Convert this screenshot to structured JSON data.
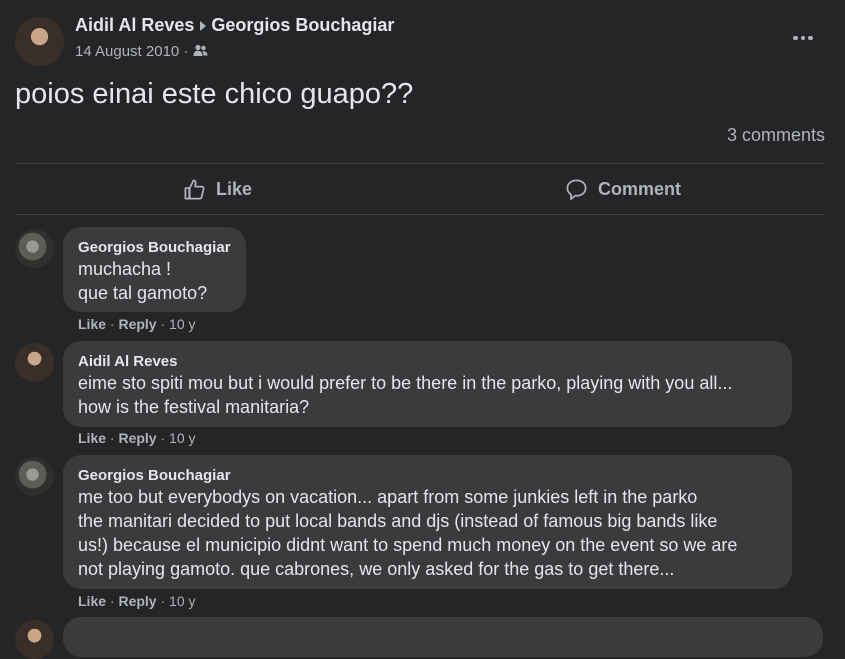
{
  "post": {
    "author": "Aidil Al Reves",
    "target": "Georgios Bouchagiar",
    "date": "14 August 2010",
    "separator": "·",
    "text": "poios einai este chico guapo??",
    "comment_count": "3 comments",
    "like_label": "Like",
    "comment_label": "Comment"
  },
  "comments": [
    {
      "author": "Georgios Bouchagiar",
      "text": "muchacha !\nque tal gamoto?",
      "like": "Like",
      "reply": "Reply",
      "time": "10 y"
    },
    {
      "author": "Aidil Al Reves",
      "text": "eime sto spiti mou but i would prefer to be there in the parko, playing with you all...\nhow is the festival manitaria?",
      "like": "Like",
      "reply": "Reply",
      "time": "10 y"
    },
    {
      "author": "Georgios Bouchagiar",
      "text": "me too but everybodys on vacation... apart from some junkies left in the parko\nthe manitari decided to put local bands and djs (instead of famous big bands like\nus!) because el municipio didnt want to spend much money on the event so we are\nnot playing gamoto. que cabrones, we only asked for the gas to get there...",
      "like": "Like",
      "reply": "Reply",
      "time": "10 y"
    }
  ],
  "icons": {
    "audience": "friends-icon",
    "more": "more-options-icon",
    "like": "thumbs-up-icon",
    "comment": "comment-bubble-icon"
  }
}
